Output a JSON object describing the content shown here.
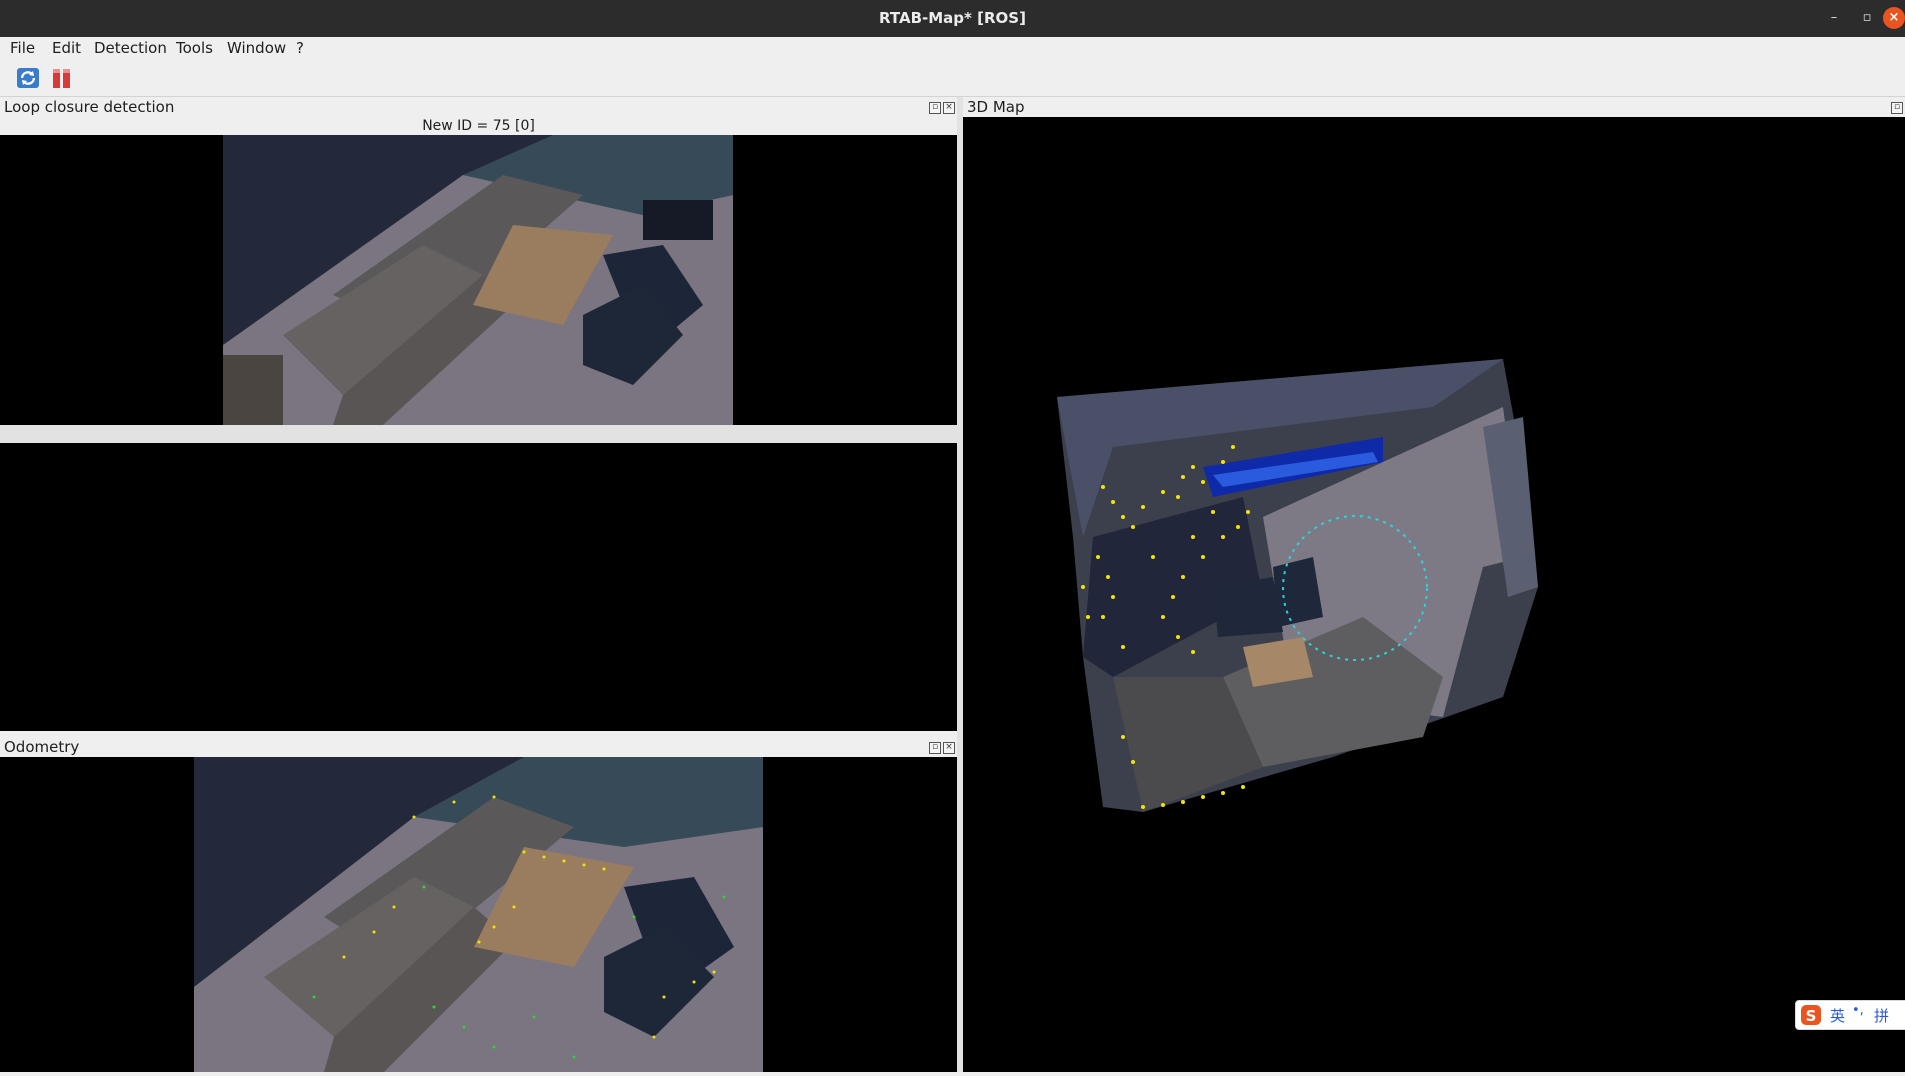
{
  "window": {
    "title": "RTAB-Map* [ROS]"
  },
  "menu": [
    "File",
    "Edit",
    "Detection",
    "Tools",
    "Window",
    "?"
  ],
  "toolbar": {
    "refresh_icon": "refresh-icon",
    "pause_icon": "pause-icon"
  },
  "loop_closure": {
    "title": "Loop closure detection",
    "new_id_label": "New ID = 75 [0]"
  },
  "map3d": {
    "title": "3D Map"
  },
  "odometry": {
    "title": "Odometry"
  },
  "ime": {
    "lang": "英",
    "punct": "•,",
    "mode": "拼"
  },
  "colors": {
    "feature_yellow": "#f2e600",
    "trajectory_cyan": "#2ad4dc",
    "accent": "#e95420"
  }
}
